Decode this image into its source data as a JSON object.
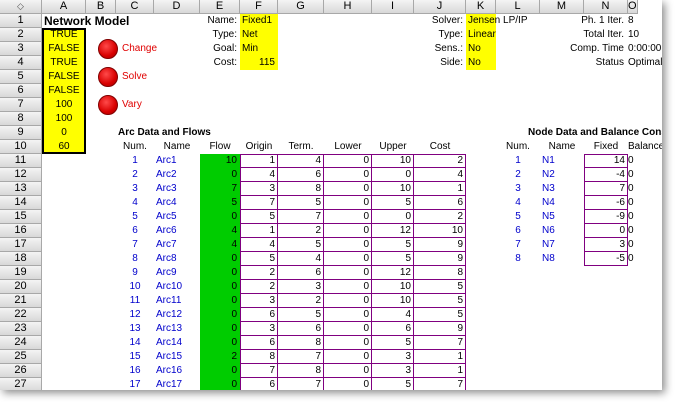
{
  "sheet": {
    "columns": [
      "A",
      "B",
      "C",
      "D",
      "E",
      "F",
      "G",
      "H",
      "I",
      "J",
      "K",
      "L",
      "M",
      "N",
      "O"
    ],
    "rows": [
      "1",
      "2",
      "3",
      "4",
      "5",
      "6",
      "7",
      "8",
      "9",
      "10",
      "11",
      "12",
      "13",
      "14",
      "15",
      "16",
      "17",
      "18",
      "19",
      "20",
      "21",
      "22",
      "23",
      "24",
      "25",
      "26",
      "27"
    ]
  },
  "model": {
    "title": "Network Model",
    "flags": [
      "TRUE",
      "FALSE",
      "TRUE",
      "FALSE",
      "FALSE",
      "100",
      "100",
      "0",
      "60"
    ]
  },
  "buttons": {
    "change": "Change",
    "solve": "Solve",
    "vary": "Vary"
  },
  "params": {
    "name_label": "Name:",
    "name_value": "Fixed1",
    "type_label": "Type:",
    "type_value": "Net",
    "goal_label": "Goal:",
    "goal_value": "Min",
    "cost_label": "Cost:",
    "cost_value": "115"
  },
  "solver": {
    "solver_label": "Solver:",
    "solver_value": "Jensen LP/IP",
    "type_label": "Type:",
    "type_value": "Linear",
    "sens_label": "Sens.:",
    "sens_value": "No",
    "side_label": "Side:",
    "side_value": "No"
  },
  "stats": {
    "ph1_label": "Ph. 1 Iter.",
    "ph1_value": "8",
    "total_label": "Total Iter.",
    "total_value": "10",
    "comp_label": "Comp. Time",
    "comp_value": "0:00:00",
    "status_label": "Status",
    "status_value": "Optimal"
  },
  "arcs": {
    "section_title": "Arc Data and Flows",
    "headers": [
      "Num.",
      "Name",
      "Flow",
      "Origin",
      "Term.",
      "Lower",
      "Upper",
      "Cost"
    ],
    "rows": [
      [
        "1",
        "Arc1",
        "10",
        "1",
        "4",
        "0",
        "10",
        "2"
      ],
      [
        "2",
        "Arc2",
        "0",
        "4",
        "6",
        "0",
        "0",
        "4"
      ],
      [
        "3",
        "Arc3",
        "7",
        "3",
        "8",
        "0",
        "10",
        "1"
      ],
      [
        "4",
        "Arc4",
        "5",
        "7",
        "5",
        "0",
        "5",
        "6"
      ],
      [
        "5",
        "Arc5",
        "0",
        "5",
        "7",
        "0",
        "0",
        "2"
      ],
      [
        "6",
        "Arc6",
        "4",
        "1",
        "2",
        "0",
        "12",
        "10"
      ],
      [
        "7",
        "Arc7",
        "4",
        "4",
        "5",
        "0",
        "5",
        "9"
      ],
      [
        "8",
        "Arc8",
        "0",
        "5",
        "4",
        "0",
        "5",
        "9"
      ],
      [
        "9",
        "Arc9",
        "0",
        "2",
        "6",
        "0",
        "12",
        "8"
      ],
      [
        "10",
        "Arc10",
        "0",
        "2",
        "3",
        "0",
        "10",
        "5"
      ],
      [
        "11",
        "Arc11",
        "0",
        "3",
        "2",
        "0",
        "10",
        "5"
      ],
      [
        "12",
        "Arc12",
        "0",
        "6",
        "5",
        "0",
        "4",
        "5"
      ],
      [
        "13",
        "Arc13",
        "0",
        "3",
        "6",
        "0",
        "6",
        "9"
      ],
      [
        "14",
        "Arc14",
        "0",
        "6",
        "8",
        "0",
        "5",
        "7"
      ],
      [
        "15",
        "Arc15",
        "2",
        "8",
        "7",
        "0",
        "3",
        "1"
      ],
      [
        "16",
        "Arc16",
        "0",
        "7",
        "8",
        "0",
        "3",
        "1"
      ],
      [
        "17",
        "Arc17",
        "0",
        "6",
        "7",
        "0",
        "5",
        "7"
      ]
    ]
  },
  "nodes": {
    "section_title": "Node Data and Balance Constraints",
    "headers": [
      "Num.",
      "Name",
      "Fixed",
      "Balance"
    ],
    "rows": [
      [
        "1",
        "N1",
        "14",
        "0"
      ],
      [
        "2",
        "N2",
        "-4",
        "0"
      ],
      [
        "3",
        "N3",
        "7",
        "0"
      ],
      [
        "4",
        "N4",
        "-6",
        "0"
      ],
      [
        "5",
        "N5",
        "-9",
        "0"
      ],
      [
        "6",
        "N6",
        "0",
        "0"
      ],
      [
        "7",
        "N7",
        "3",
        "0"
      ],
      [
        "8",
        "N8",
        "-5",
        "0"
      ]
    ]
  }
}
